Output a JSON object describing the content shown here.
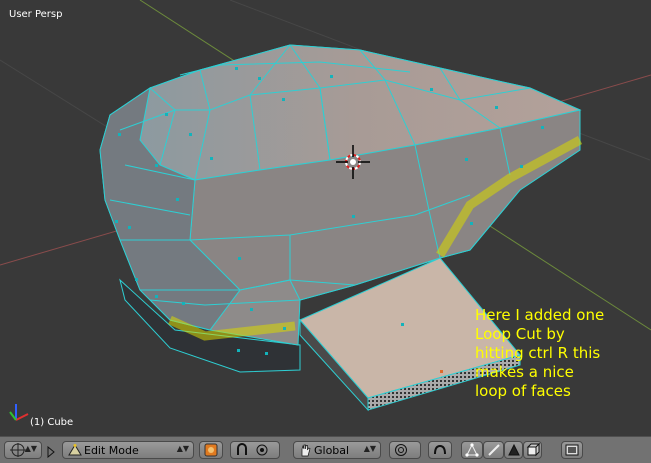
{
  "viewport": {
    "view_name": "User Persp",
    "object_name": "(1) Cube",
    "annotation": "Here I added one\nLoop Cut by\nhitting ctrl R this\nmakes a nice\nloop of faces"
  },
  "header": {
    "mode": "Edit Mode",
    "orientation": "Global"
  },
  "colors": {
    "background": "#393939",
    "mesh_face": "#9a8a84",
    "edge": "#2ecfd3",
    "loop_highlight": "#d8d800",
    "annotation_text": "#ffff00",
    "header_bar": "#727272"
  },
  "icons": [
    "editor-type-icon",
    "expand-triangle-icon",
    "mode-triangle-icon",
    "shading-sphere-icon",
    "pivot-icon",
    "manipulator-hand-icon",
    "proportional-edit-icon",
    "snap-magnet-icon",
    "vertex-select-icon",
    "edge-select-icon",
    "face-select-icon",
    "occlude-geometry-icon",
    "render-image-icon"
  ]
}
